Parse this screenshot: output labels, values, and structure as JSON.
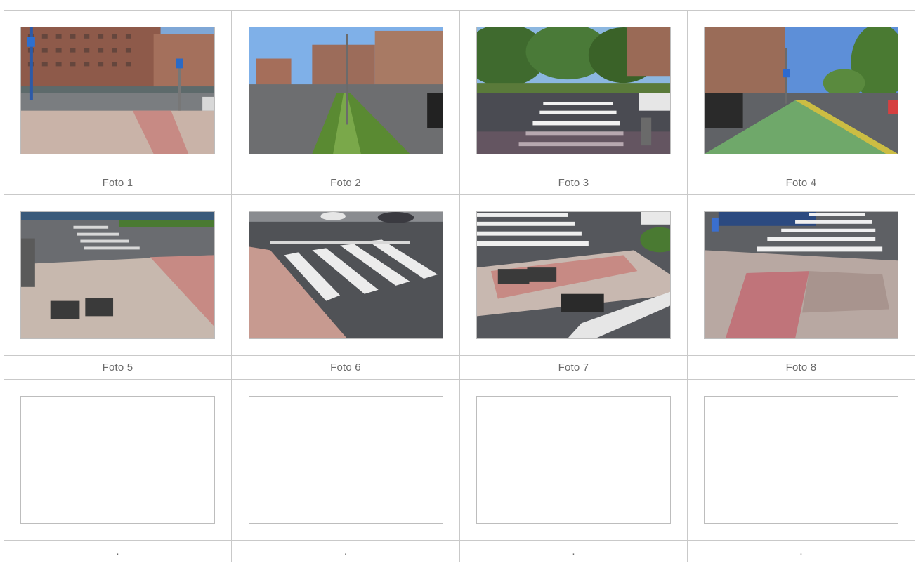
{
  "photos": [
    {
      "caption": "Foto 1",
      "scene": "street-corner-buildings"
    },
    {
      "caption": "Foto 2",
      "scene": "avenue-median-hedge"
    },
    {
      "caption": "Foto 3",
      "scene": "crosswalk-park-trees"
    },
    {
      "caption": "Foto 4",
      "scene": "green-bike-lane-avenue"
    },
    {
      "caption": "Foto 5",
      "scene": "tactile-paving-corner"
    },
    {
      "caption": "Foto 6",
      "scene": "crosswalk-curb-ramp"
    },
    {
      "caption": "Foto 7",
      "scene": "pink-paving-drains"
    },
    {
      "caption": "Foto 8",
      "scene": "tactile-paving-crosswalk"
    },
    {
      "caption": ".",
      "scene": "empty"
    },
    {
      "caption": ".",
      "scene": "empty"
    },
    {
      "caption": ".",
      "scene": "empty"
    },
    {
      "caption": ".",
      "scene": "empty"
    }
  ],
  "colors": {
    "border": "#c9c9c9",
    "caption_text": "#6b6b6b"
  }
}
